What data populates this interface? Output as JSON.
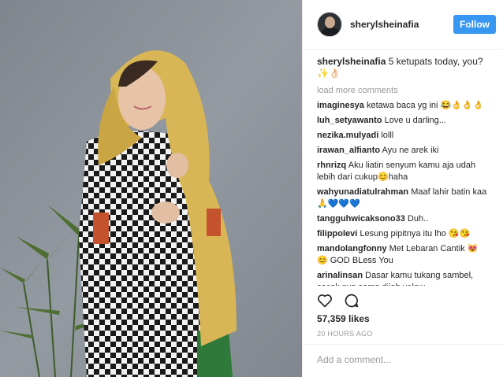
{
  "post": {
    "username": "sherylsheinafia",
    "follow_label": "Follow",
    "caption_user": "sherylsheinafia",
    "caption_text": " 5 ketupats today, you? ✨👌🏻",
    "load_more": "load more comments",
    "comments": [
      {
        "user": "imaginesya",
        "text": " ketawa baca yg ini 😂👌👌👌"
      },
      {
        "user": "luh_setyawanto",
        "text": " Love u darling..."
      },
      {
        "user": "nezika.mulyadi",
        "text": " lolll"
      },
      {
        "user": "irawan_alfianto",
        "text": " Ayu ne arek iki"
      },
      {
        "user": "rhnrizq",
        "text": " Aku liatin senyum kamu aja udah lebih dari cukup😊haha"
      },
      {
        "user": "wahyunadiatulrahman",
        "text": " Maaf lahir batin kaa 🙏💙💙💙"
      },
      {
        "user": "tangguhwicaksono33",
        "text": " Duh.."
      },
      {
        "user": "filippolevi",
        "text": " Lesung pipitnya itu lho 😘😘"
      },
      {
        "user": "mandolangfonny",
        "text": " Met Lebaran Cantik 😻😊 GOD BLess You"
      },
      {
        "user": "arinalinsan",
        "text": " Dasar kamu tukang sambel, cocok nya sama dijah yelow"
      }
    ],
    "likes": "57,359 likes",
    "time": "20 HOURS AGO",
    "add_comment_placeholder": "Add a comment..."
  },
  "icons": {
    "like": "heart-icon",
    "comment": "comment-icon"
  },
  "colors": {
    "follow_button": "#3897f0",
    "muted": "#999999"
  }
}
